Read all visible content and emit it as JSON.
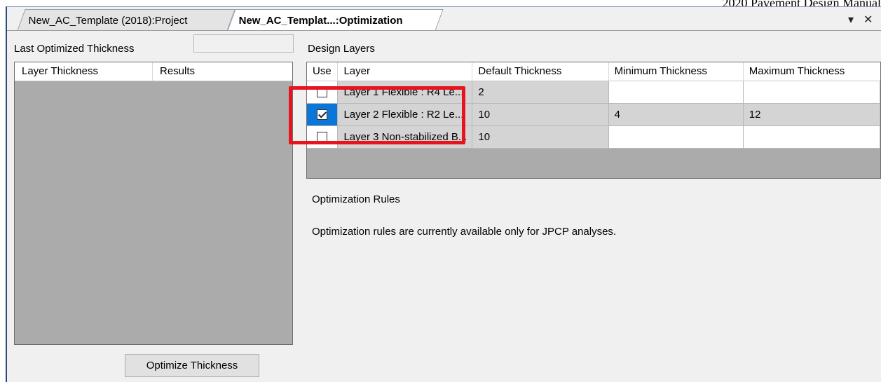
{
  "document_header": "2020 Pavement Design Manual",
  "tabs": [
    {
      "label": "New_AC_Template (2018):Project",
      "active": false
    },
    {
      "label": "New_AC_Templat...:Optimization",
      "active": true
    }
  ],
  "tab_controls": {
    "dropdown": "▾",
    "close": "✕"
  },
  "left_panel": {
    "last_optimized_label": "Last Optimized Thickness",
    "last_optimized_value": "",
    "columns": [
      "Layer Thickness",
      "Results"
    ],
    "button_label": "Optimize Thickness"
  },
  "design_layers": {
    "title": "Design Layers",
    "columns": [
      "Use",
      "Layer",
      "Default Thickness",
      "Minimum Thickness",
      "Maximum Thickness"
    ],
    "rows": [
      {
        "use": false,
        "layer": "Layer 1 Flexible : R4 Le...",
        "default": "2",
        "min": "",
        "max": ""
      },
      {
        "use": true,
        "layer": "Layer 2 Flexible : R2 Le...",
        "default": "10",
        "min": "4",
        "max": "12"
      },
      {
        "use": false,
        "layer": "Layer 3 Non-stabilized B...",
        "default": "10",
        "min": "",
        "max": ""
      }
    ]
  },
  "optimization_rules": {
    "title": "Optimization Rules",
    "message": "Optimization rules are currently available only for JPCP analyses."
  },
  "colors": {
    "highlight": "#e8141d",
    "selection": "#0a77d8"
  }
}
